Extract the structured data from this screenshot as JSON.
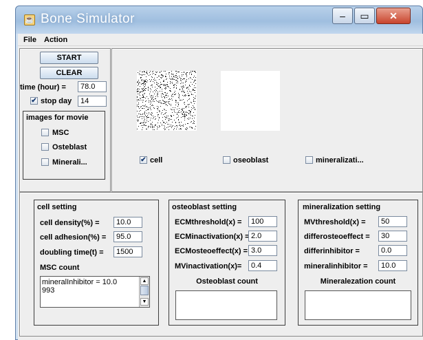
{
  "window": {
    "title": "Bone Simulator"
  },
  "menu": [
    "File",
    "Action"
  ],
  "controls": {
    "start_label": "START",
    "clear_label": "CLEAR",
    "time_label": "time (hour) =",
    "time_value": "78.0",
    "stop_day_label": "stop day",
    "stop_day_checked": true,
    "stop_day_value": "14",
    "images_group_title": "images for movie",
    "images_options": [
      {
        "label": "MSC",
        "checked": false
      },
      {
        "label": "Osteblast",
        "checked": false
      },
      {
        "label": "Minerali...",
        "checked": false
      }
    ]
  },
  "display": {
    "layers": [
      {
        "label": "cell",
        "checked": true
      },
      {
        "label": "oseoblast",
        "checked": false
      },
      {
        "label": "mineralizati...",
        "checked": false
      }
    ]
  },
  "cell_setting": {
    "title": "cell setting",
    "fields": [
      {
        "label": "cell density(%) =",
        "value": "10.0"
      },
      {
        "label": "cell adhesion(%) =",
        "value": "95.0"
      },
      {
        "label": "doubling time(t) =",
        "value": "1500"
      }
    ],
    "count_label": "MSC count",
    "log_lines": [
      "mineralInhibitor = 10.0",
      "993"
    ]
  },
  "osteoblast_setting": {
    "title": "osteoblast setting",
    "fields": [
      {
        "label": "ECMthreshold(x) =",
        "value": "100"
      },
      {
        "label": "ECMinactivation(x) =",
        "value": "2.0"
      },
      {
        "label": "ECMosteoeffect(x) =",
        "value": "3.0"
      },
      {
        "label": "MVinactivation(x)=",
        "value": "0.4"
      }
    ],
    "count_label": "Osteoblast count"
  },
  "mineralization_setting": {
    "title": "mineralization setting",
    "fields": [
      {
        "label": "MVthreshold(x) =",
        "value": "50"
      },
      {
        "label": "differosteoeffect =",
        "value": "30"
      },
      {
        "label": "differinhibitor =",
        "value": "0.0"
      },
      {
        "label": "mineralinhibitor =",
        "value": "10.0"
      }
    ],
    "count_label": "Mineralezation count"
  },
  "icons": [
    "java-app-icon",
    "minimize-icon",
    "maximize-icon",
    "close-icon",
    "scroll-up-icon",
    "scroll-down-icon",
    "checkmark-icon"
  ]
}
